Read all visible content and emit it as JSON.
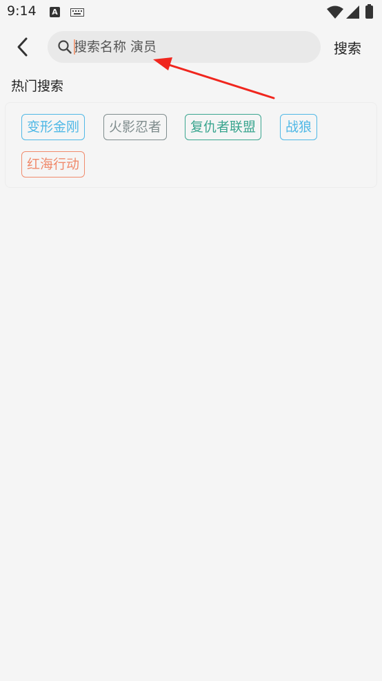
{
  "status_bar": {
    "time": "9:14",
    "notification_icon_letter": "A",
    "icons": [
      "text-notification-icon",
      "keyboard-icon",
      "wifi-icon",
      "signal-icon",
      "battery-icon"
    ]
  },
  "header": {
    "back_icon": "chevron-left-icon",
    "search": {
      "placeholder": "搜索名称 演员",
      "value": "",
      "icon": "search-icon"
    },
    "search_button_label": "搜索"
  },
  "hot_search": {
    "title": "热门搜索",
    "tags": [
      {
        "label": "变形金刚",
        "color": "#4fb8e6"
      },
      {
        "label": "火影忍者",
        "color": "#7f8c8d"
      },
      {
        "label": "复仇者联盟",
        "color": "#3aa58f"
      },
      {
        "label": "战狼",
        "color": "#4fb8e6"
      },
      {
        "label": "红海行动",
        "color": "#f08a6c"
      }
    ]
  },
  "annotation": {
    "arrow_color": "#f0261e"
  }
}
